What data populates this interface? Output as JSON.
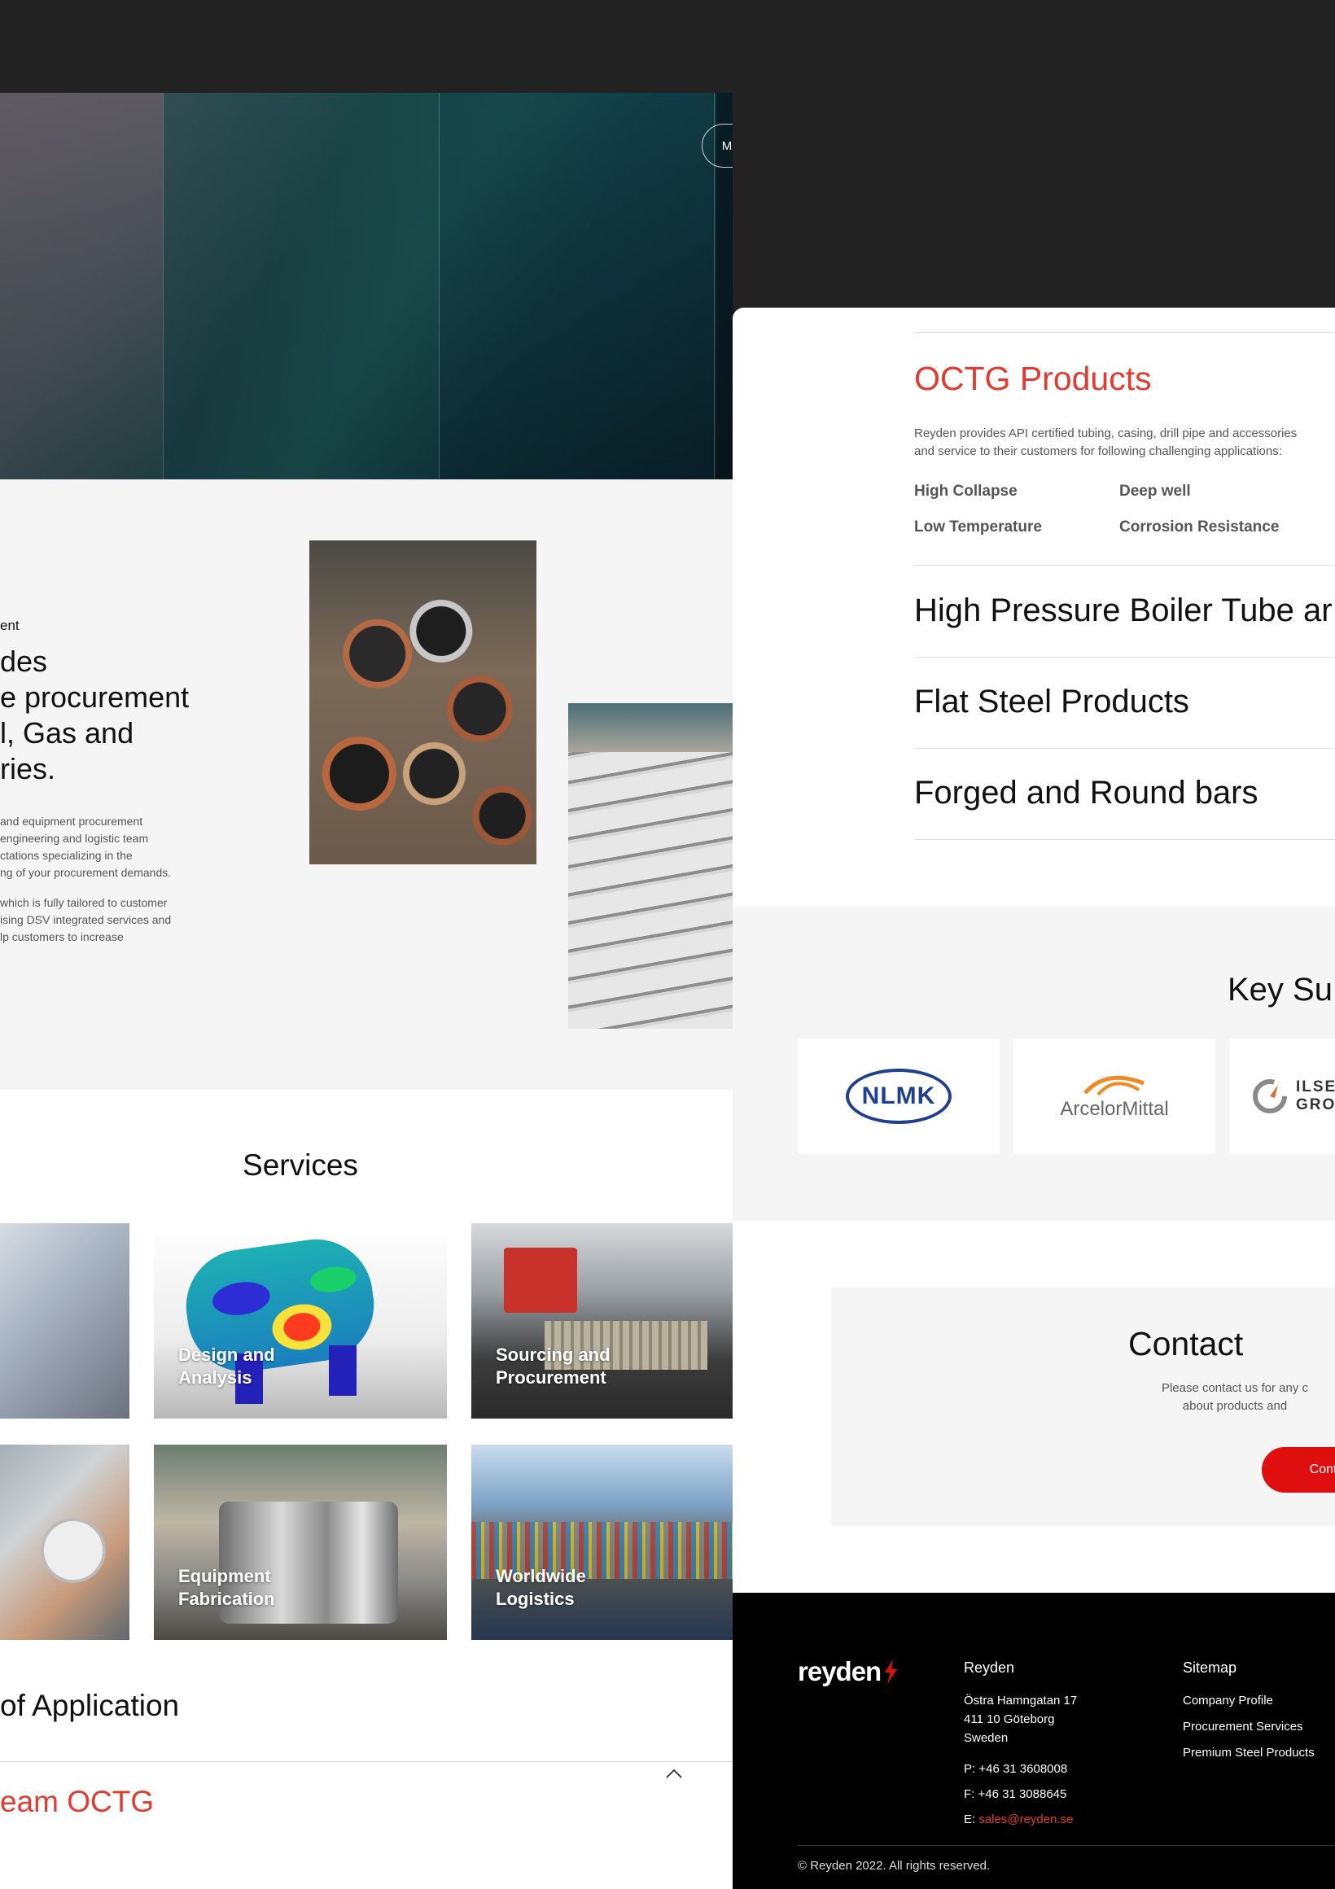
{
  "header": {
    "menu_label": "Menu"
  },
  "about": {
    "eyebrow": "ent",
    "heading_lines": [
      "des",
      "e procurement",
      "l, Gas and",
      "ries."
    ],
    "body1_lines": [
      " and equipment procurement",
      "engineering and logistic team",
      "ctations specializing in the",
      "ng of your procurement demands."
    ],
    "body2_lines": [
      "which is fully tailored to customer",
      "ising DSV integrated services and",
      "lp customers to increase"
    ]
  },
  "services": {
    "title": "Services",
    "items": [
      {
        "label": "Design and Analysis"
      },
      {
        "label": "Sourcing and Procurement"
      },
      {
        "label": "Equipment Fabrication"
      },
      {
        "label": "Worldwide Logistics"
      }
    ]
  },
  "applications": {
    "title": " of Application",
    "first_item": "eam OCTG"
  },
  "products": {
    "octg_title": "OCTG Products",
    "octg_desc_lines": [
      "Reyden provides API certified tubing, casing, drill pipe and accessories",
      "and service to their customers for following challenging applications:"
    ],
    "octg_apps": [
      "High Collapse",
      "Deep well",
      "Low Temperature",
      "Corrosion Resistance"
    ],
    "items": [
      "High Pressure Boiler Tube ar",
      "Flat Steel Products",
      "Forged and Round bars"
    ]
  },
  "suppliers": {
    "title": "Key Su",
    "logos": [
      "NLMK",
      "ArcelorMittal",
      "ILSE",
      "GRO"
    ]
  },
  "contact": {
    "title": "Contact",
    "text_lines": [
      "Please contact us for any c",
      "about products and"
    ],
    "button_label": "Conta"
  },
  "footer": {
    "logo_text": "reyden",
    "company_heading": "Reyden",
    "address_lines": [
      "Östra Hamngatan 17",
      "411 10 Göteborg",
      "Sweden"
    ],
    "phone": "P: +46 31 3608008",
    "fax": "F: +46 31 3088645",
    "email_prefix": "E: ",
    "email": "sales@reyden.se",
    "sitemap_heading": "Sitemap",
    "sitemap_links": [
      "Company Profile",
      "Procurement Services",
      "Premium Steel Products"
    ],
    "copyright": "© Reyden 2022. All rights reserved."
  },
  "colors": {
    "accent_red": "#e03c31",
    "button_red": "#e00f0f",
    "page_bg_dark": "#222222",
    "section_gray": "#f5f5f5",
    "footer_bg": "#000000"
  },
  "icons": [
    "hamburger-icon",
    "chevron-up-icon",
    "reyden-logo-icon"
  ]
}
